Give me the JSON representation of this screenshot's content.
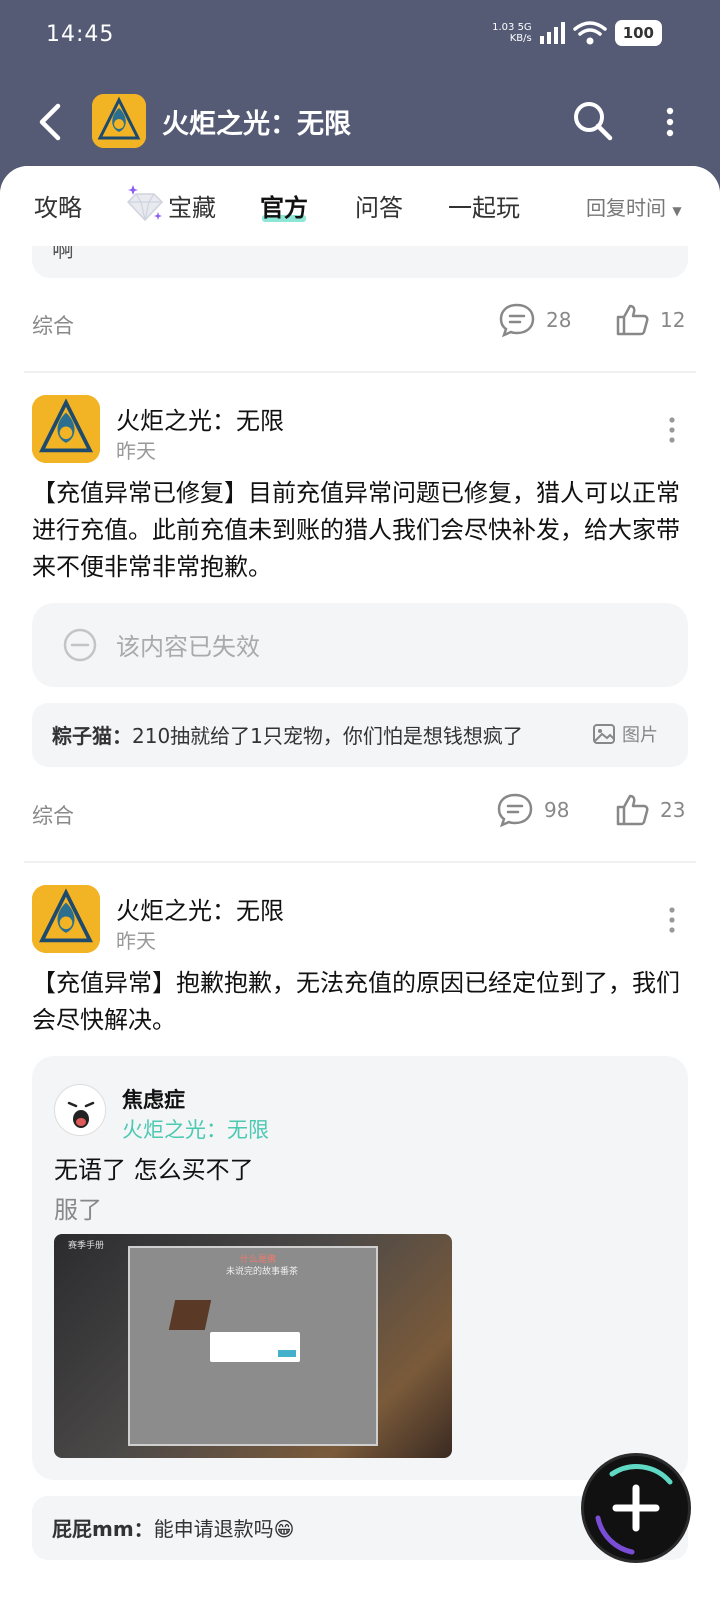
{
  "status_bar": {
    "time": "14:45",
    "net_speed": "1.03",
    "net_unit": "KB/s",
    "net_type": "5G",
    "wifi_level": "6",
    "battery": "100"
  },
  "header": {
    "title": "火炬之光：无限",
    "back_icon": "back-arrow-icon",
    "search_icon": "search-icon",
    "more_icon": "more-vertical-icon"
  },
  "tabs": {
    "items": [
      "攻略",
      "宝藏",
      "官方",
      "问答",
      "一起玩"
    ],
    "active": "官方",
    "sort_label": "回复时间"
  },
  "feed": {
    "prev_snippet": "啊",
    "prev_footer": {
      "category": "综合",
      "comments": "28",
      "likes": "12"
    },
    "posts": [
      {
        "author": "火炬之光：无限",
        "date": "昨天",
        "text": "【充值异常已修复】目前充值异常问题已修复，猎人可以正常进行充值。此前充值未到账的猎人我们会尽快补发，给大家带来不便非常非常抱歉。",
        "invalid_notice": "该内容已失效",
        "top_comment": {
          "user": "粽子猫：",
          "text": "210抽就给了1只宠物，你们怕是想钱想疯了",
          "image_tag": "图片"
        },
        "footer": {
          "category": "综合",
          "comments": "98",
          "likes": "23"
        }
      },
      {
        "author": "火炬之光：无限",
        "date": "昨天",
        "text": "【充值异常】抱歉抱歉，无法充值的原因已经定位到了，我们会尽快解决。",
        "quote": {
          "user": "焦虑症",
          "game": "火炬之光：无限",
          "line1": "无语了 怎么买不了",
          "line2": "服了",
          "image_texts": {
            "back_label": "赛季手册",
            "dialog_title": "什么是佛",
            "dialog_subtitle": "未说完的故事番茶"
          }
        },
        "top_comment": {
          "user": "屁屁mm：",
          "text": "能申请退款吗😁"
        }
      }
    ]
  },
  "colors": {
    "header_bg": "#555b75",
    "accent_teal": "#4cc9b0",
    "app_icon_gold": "#f2b424"
  }
}
